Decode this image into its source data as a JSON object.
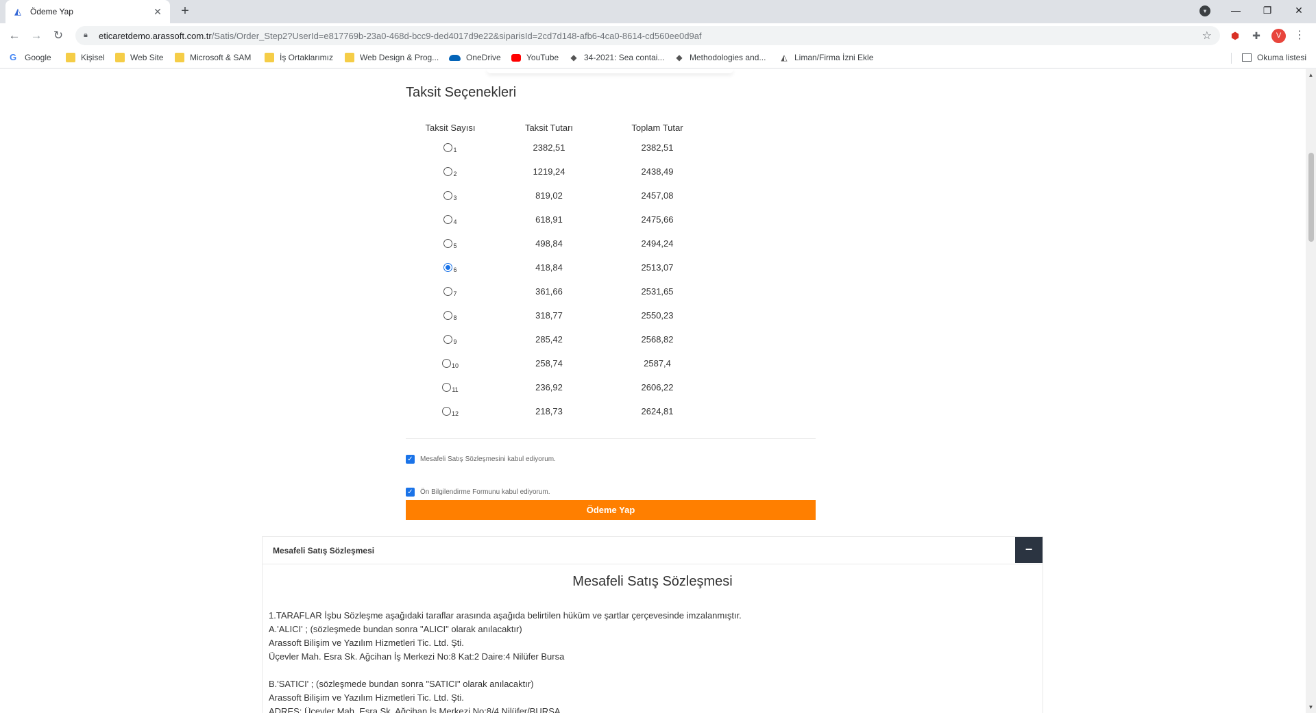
{
  "browser": {
    "tab_title": "Ödeme Yap",
    "url_host": "eticaretdemo.arassoft.com.tr",
    "url_path": "/Satis/Order_Step2?UserId=e817769b-23a0-468d-bcc9-ded4017d9e22&siparisId=2cd7d148-afb6-4ca0-8614-cd560ee0d9af",
    "avatar_letter": "V",
    "bookmarks": [
      {
        "label": "Google",
        "icon": "google-icon"
      },
      {
        "label": "Kişisel",
        "icon": "folder-icon"
      },
      {
        "label": "Web Site",
        "icon": "folder-icon"
      },
      {
        "label": "Microsoft & SAM",
        "icon": "folder-icon"
      },
      {
        "label": "İş Ortaklarımız",
        "icon": "folder-icon"
      },
      {
        "label": "Web Design & Prog...",
        "icon": "folder-icon"
      },
      {
        "label": "OneDrive",
        "icon": "onedrive-icon"
      },
      {
        "label": "YouTube",
        "icon": "youtube-icon"
      },
      {
        "label": "34-2021: Sea contai...",
        "icon": "site-icon"
      },
      {
        "label": "Methodologies and...",
        "icon": "site-icon"
      },
      {
        "label": "Liman/Firma İzni Ekle",
        "icon": "site-icon"
      }
    ],
    "reading_list": "Okuma listesi"
  },
  "installments": {
    "title": "Taksit Seçenekleri",
    "headers": [
      "Taksit Sayısı",
      "Taksit Tutarı",
      "Toplam Tutar"
    ],
    "selected_index": 5,
    "rows": [
      {
        "count": "1",
        "amount": "2382,51",
        "total": "2382,51"
      },
      {
        "count": "2",
        "amount": "1219,24",
        "total": "2438,49"
      },
      {
        "count": "3",
        "amount": "819,02",
        "total": "2457,08"
      },
      {
        "count": "4",
        "amount": "618,91",
        "total": "2475,66"
      },
      {
        "count": "5",
        "amount": "498,84",
        "total": "2494,24"
      },
      {
        "count": "6",
        "amount": "418,84",
        "total": "2513,07"
      },
      {
        "count": "7",
        "amount": "361,66",
        "total": "2531,65"
      },
      {
        "count": "8",
        "amount": "318,77",
        "total": "2550,23"
      },
      {
        "count": "9",
        "amount": "285,42",
        "total": "2568,82"
      },
      {
        "count": "10",
        "amount": "258,74",
        "total": "2587,4"
      },
      {
        "count": "11",
        "amount": "236,92",
        "total": "2606,22"
      },
      {
        "count": "12",
        "amount": "218,73",
        "total": "2624,81"
      }
    ]
  },
  "agreements": {
    "distance_sales": "Mesafeli Satış Sözleşmesini kabul ediyorum.",
    "pre_info": "Ön Bilgilendirme Formunu kabul ediyorum."
  },
  "pay_button": "Ödeme Yap",
  "contract": {
    "panel_header": "Mesafeli Satış Sözleşmesi",
    "collapse_symbol": "−",
    "title": "Mesafeli Satış Sözleşmesi",
    "lines": [
      "1.TARAFLAR İşbu Sözleşme aşağıdaki taraflar arasında aşağıda belirtilen hüküm ve şartlar çerçevesinde imzalanmıştır.",
      "A.'ALICI' ; (sözleşmede bundan sonra \"ALICI\" olarak anılacaktır)",
      "Arassoft Bilişim ve Yazılım Hizmetleri Tic. Ltd. Şti.",
      "Üçevler Mah. Esra Sk. Ağcihan İş Merkezi No:8 Kat:2 Daire:4 Nilüfer Bursa",
      "",
      "B.'SATICI' ; (sözleşmede bundan sonra \"SATICI\" olarak anılacaktır)",
      "Arassoft Bilişim ve Yazılım Hizmetleri Tic. Ltd. Şti.",
      "ADRES: Üçevler Mah. Esra Sk. Ağcihan İş Merkezi No:8/4 Nilüfer/BURSA"
    ]
  },
  "colors": {
    "pay_button": "#ff7f00",
    "collapse_button": "#2b3441",
    "accent": "#1a73e8"
  }
}
